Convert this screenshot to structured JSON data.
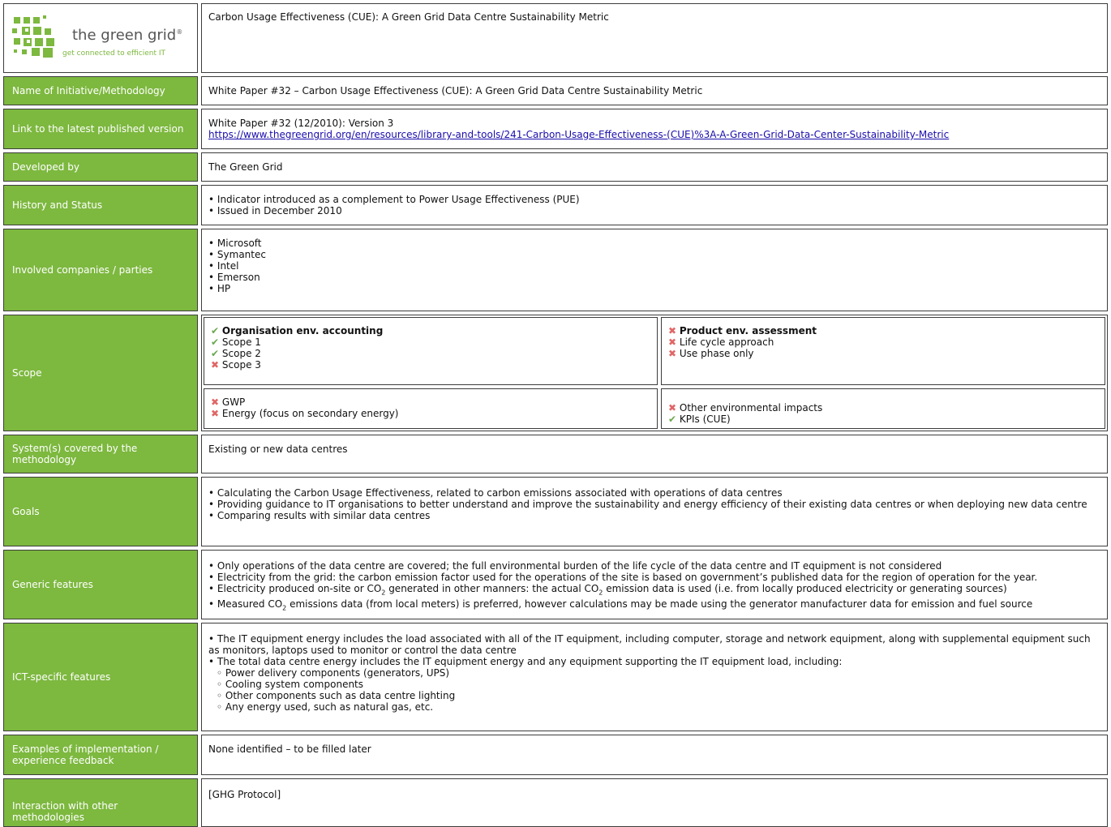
{
  "logo": {
    "brand": "the green grid",
    "registered": "®",
    "tagline": "get connected to efficient IT"
  },
  "header_title": "Carbon Usage Effectiveness (CUE): A Green Grid Data Centre Sustainability Metric",
  "rows": {
    "name": {
      "label": "Name of Initiative/Methodology",
      "value": "White Paper #32 – Carbon Usage Effectiveness (CUE): A Green Grid Data Centre Sustainability Metric"
    },
    "link": {
      "label": "Link to the latest published version",
      "version": "White Paper #32 (12/2010): Version 3",
      "url": "https://www.thegreengrid.org/en/resources/library-and-tools/241-Carbon-Usage-Effectiveness-(CUE)%3A-A-Green-Grid-Data-Center-Sustainability-Metric"
    },
    "developed": {
      "label": "Developed by",
      "value": "The Green Grid"
    },
    "history": {
      "label": "History and Status",
      "items": [
        "Indicator introduced as a complement to Power Usage Effectiveness (PUE)",
        "Issued in December 2010"
      ]
    },
    "companies": {
      "label": "Involved companies / parties",
      "items": [
        "Microsoft",
        "Symantec",
        "Intel",
        "Emerson",
        "HP"
      ]
    },
    "scope": {
      "label": "Scope",
      "org_title": "Organisation env. accounting",
      "scope1": "Scope 1",
      "scope2": "Scope 2",
      "scope3": "Scope 3",
      "product_title": "Product env. assessment",
      "lifecycle": "Life cycle approach",
      "usephase": "Use phase only",
      "gwp": "GWP",
      "energy": "Energy (focus on secondary energy)",
      "other_impacts": "Other environmental impacts",
      "kpis": "KPIs (CUE)"
    },
    "systems": {
      "label": "System(s) covered by the methodology",
      "value": "Existing or new data centres"
    },
    "goals": {
      "label": "Goals",
      "items": [
        "Calculating the Carbon Usage Effectiveness, related to carbon emissions associated with operations of data centres",
        "Providing guidance to IT organisations to better understand and improve the sustainability and energy efficiency of their existing data centres or when deploying new data centre",
        "Comparing results with similar data centres"
      ]
    },
    "generic": {
      "label": "Generic features",
      "item1": "Only operations of the data centre are covered; the full environmental burden of the life cycle of the data centre and IT equipment is not considered",
      "item2": "Electricity from the grid: the carbon emission factor used for the operations of the site is based on government’s published data for the region of operation for the year.",
      "item3_a": "Electricity produced on-site or CO",
      "item3_b": " generated in other manners: the actual CO",
      "item3_c": " emission data is used (i.e. from locally produced electricity or generating sources)",
      "item4_a": "Measured CO",
      "item4_b": " emissions data (from local meters) is preferred, however calculations may be made using the generator manufacturer data for emission and fuel source",
      "sub2": "2"
    },
    "ict": {
      "label": "ICT-specific features",
      "item1": "The IT equipment energy includes the load associated with all of the IT equipment, including computer, storage and network equipment, along with supplemental equipment such as monitors, laptops used to monitor or control the data centre",
      "item2": "The total data centre energy includes the IT equipment energy and any equipment supporting the IT equipment load, including:",
      "subitems": [
        "Power delivery components (generators, UPS)",
        "Cooling system components",
        "Other components such as data centre lighting",
        "Any energy used, such as natural gas, etc."
      ]
    },
    "examples": {
      "label": "Examples of implementation / experience feedback",
      "value": "None identified – to be filled later"
    },
    "interaction": {
      "label": "Interaction with other methodologies",
      "value": "[GHG Protocol]"
    }
  },
  "colors": {
    "label_bg": "#7db83f",
    "check": "#6aa84f",
    "cross": "#e06666",
    "link": "#1a0dab"
  }
}
